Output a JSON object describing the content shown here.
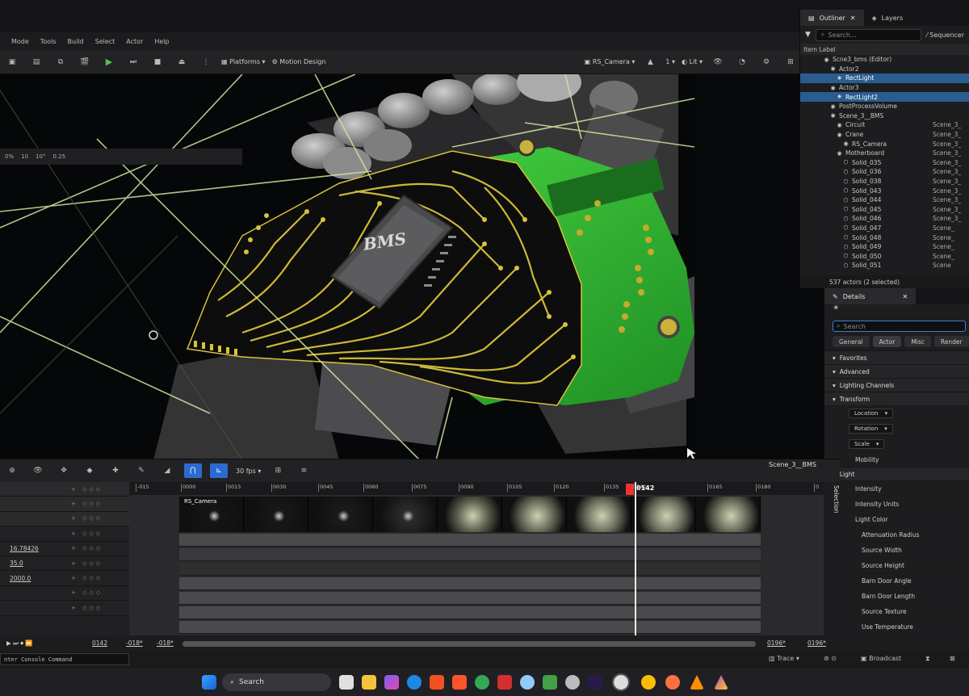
{
  "menu": [
    "Mode",
    "Tools",
    "Build",
    "Select",
    "Actor",
    "Help"
  ],
  "toolbar": {
    "platforms": "Platforms",
    "motion_design": "Motion Design",
    "camera": "RS_Camera",
    "lit": "Lit",
    "viewport_count": "1"
  },
  "vp_toolbar": [
    "0%",
    "10",
    "10°",
    "0.25"
  ],
  "outliner": {
    "tab": "Outliner",
    "tab2": "Layers",
    "search_placeholder": "Search...",
    "sequencer_btn": "Sequencer",
    "column": "Item Label",
    "items": [
      {
        "label": "Scne3_bms (Editor)",
        "indent": 0,
        "sel": false,
        "type": ""
      },
      {
        "label": "Actor2",
        "indent": 1,
        "sel": false,
        "type": ""
      },
      {
        "label": "RectLight",
        "indent": 2,
        "sel": true,
        "type": ""
      },
      {
        "label": "Actor3",
        "indent": 1,
        "sel": false,
        "type": ""
      },
      {
        "label": "RectLight2",
        "indent": 2,
        "sel": true,
        "type": ""
      },
      {
        "label": "PostProcessVolume",
        "indent": 1,
        "sel": false,
        "type": ""
      },
      {
        "label": "Scene_3__BMS",
        "indent": 1,
        "sel": false,
        "type": ""
      },
      {
        "label": "Circuit",
        "indent": 2,
        "sel": false,
        "type": "Scene_3_"
      },
      {
        "label": "Crane",
        "indent": 2,
        "sel": false,
        "type": "Scene_3_"
      },
      {
        "label": "RS_Camera",
        "indent": 3,
        "sel": false,
        "type": "Scene_3_"
      },
      {
        "label": "Motherboard",
        "indent": 2,
        "sel": false,
        "type": "Scene_3_"
      },
      {
        "label": "Solid_035",
        "indent": 3,
        "sel": false,
        "type": "Scene_3_"
      },
      {
        "label": "Solid_036",
        "indent": 3,
        "sel": false,
        "type": "Scene_3_"
      },
      {
        "label": "Solid_038",
        "indent": 3,
        "sel": false,
        "type": "Scene_3_"
      },
      {
        "label": "Solid_043",
        "indent": 3,
        "sel": false,
        "type": "Scene_3_"
      },
      {
        "label": "Solid_044",
        "indent": 3,
        "sel": false,
        "type": "Scene_3_"
      },
      {
        "label": "Solid_045",
        "indent": 3,
        "sel": false,
        "type": "Scene_3_"
      },
      {
        "label": "Solid_046",
        "indent": 3,
        "sel": false,
        "type": "Scene_3_"
      },
      {
        "label": "Solid_047",
        "indent": 3,
        "sel": false,
        "type": "Scene_"
      },
      {
        "label": "Solid_048",
        "indent": 3,
        "sel": false,
        "type": "Scene_"
      },
      {
        "label": "Solid_049",
        "indent": 3,
        "sel": false,
        "type": "Scene_"
      },
      {
        "label": "Solid_050",
        "indent": 3,
        "sel": false,
        "type": "Scene_"
      },
      {
        "label": "Solid_051",
        "indent": 3,
        "sel": false,
        "type": "Scene"
      }
    ],
    "footer": "537 actors (2 selected)"
  },
  "details": {
    "tab": "Details",
    "search_placeholder": "Search",
    "filters": [
      "General",
      "Actor",
      "Misc",
      "Render"
    ],
    "rows": [
      {
        "kind": "cat",
        "label": "Favorites"
      },
      {
        "kind": "cat",
        "label": "Advanced"
      },
      {
        "kind": "cat",
        "label": "Lighting Channels"
      },
      {
        "kind": "cat",
        "label": "Transform"
      },
      {
        "kind": "drop",
        "label": "Location"
      },
      {
        "kind": "drop",
        "label": "Rotation"
      },
      {
        "kind": "drop",
        "label": "Scale"
      },
      {
        "kind": "prop",
        "label": "Mobility"
      },
      {
        "kind": "cat",
        "label": "Light"
      },
      {
        "kind": "prop",
        "label": "Intensity"
      },
      {
        "kind": "prop",
        "label": "Intensity Units"
      },
      {
        "kind": "prop",
        "label": "Light Color"
      },
      {
        "kind": "sub",
        "label": "Attenuation Radius"
      },
      {
        "kind": "sub",
        "label": "Source Width"
      },
      {
        "kind": "sub",
        "label": "Source Height"
      },
      {
        "kind": "sub",
        "label": "Barn Door Angle"
      },
      {
        "kind": "sub",
        "label": "Barn Door Length"
      },
      {
        "kind": "sub",
        "label": "Source Texture"
      },
      {
        "kind": "sub",
        "label": "Use Temperature"
      }
    ]
  },
  "viewport": {
    "chip_label": "BMS"
  },
  "sequencer": {
    "fps": "30 fps",
    "sequence_name": "Scene_3__BMS",
    "selection_label": "Selection",
    "ruler": [
      "-015",
      "0000",
      "0015",
      "0030",
      "0045",
      "0060",
      "0075",
      "0090",
      "0105",
      "0120",
      "0135",
      "0142",
      "0165",
      "0180",
      "0"
    ],
    "playhead": "0142",
    "clip_label": "RS_Camera",
    "tracks": [
      {
        "value": ""
      },
      {
        "value": ""
      },
      {
        "value": ""
      },
      {
        "value": ""
      },
      {
        "value": "16.78426"
      },
      {
        "value": "35.0"
      },
      {
        "value": "2000.0"
      },
      {
        "value": ""
      },
      {
        "value": ""
      }
    ],
    "footer": {
      "current": "0142",
      "start_a": "-018*",
      "start_b": "-018*",
      "end_a": "0196*",
      "end_b": "0196*"
    }
  },
  "status": {
    "console": "nter Console Command",
    "trace": "Trace",
    "broadcast": "Broadcast"
  },
  "taskbar": {
    "search": "Search"
  },
  "colors": {
    "pcb_green": "#3fd23c",
    "trace_gold": "#d9c23a",
    "selection_blue": "#2a5d8f",
    "keyframe_teal": "#2aa79c"
  }
}
